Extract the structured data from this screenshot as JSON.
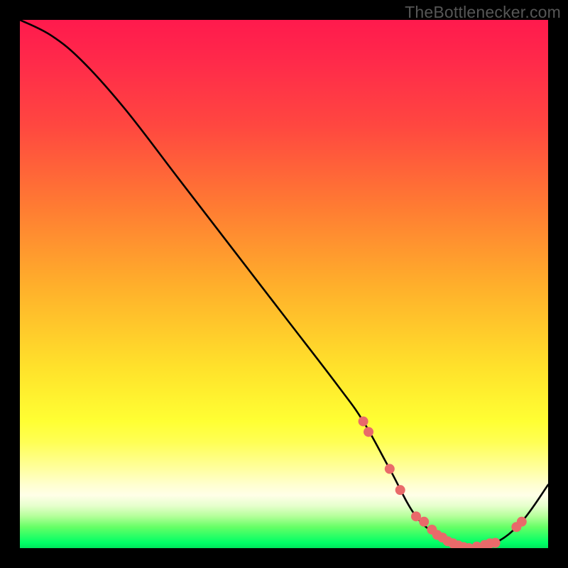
{
  "watermark": "TheBottlenecker.com",
  "chart_data": {
    "type": "line",
    "title": "",
    "xlabel": "",
    "ylabel": "",
    "xlim": [
      0,
      100
    ],
    "ylim": [
      0,
      100
    ],
    "series": [
      {
        "name": "curve",
        "x": [
          0,
          6,
          12,
          20,
          30,
          40,
          50,
          60,
          65,
          70,
          75,
          80,
          85,
          90,
          95,
          100
        ],
        "y": [
          100,
          97,
          92,
          83,
          70,
          57,
          44,
          31,
          24,
          15,
          6,
          2,
          0,
          1,
          5,
          12
        ]
      }
    ],
    "markers": {
      "color": "#e96a6a",
      "radius_px": 7,
      "points": [
        {
          "x": 65,
          "y": 24
        },
        {
          "x": 66,
          "y": 22
        },
        {
          "x": 70,
          "y": 15
        },
        {
          "x": 72,
          "y": 11
        },
        {
          "x": 75,
          "y": 6
        },
        {
          "x": 76.5,
          "y": 5
        },
        {
          "x": 78,
          "y": 3.5
        },
        {
          "x": 79,
          "y": 2.5
        },
        {
          "x": 80,
          "y": 2
        },
        {
          "x": 81,
          "y": 1.3
        },
        {
          "x": 82,
          "y": 0.9
        },
        {
          "x": 83,
          "y": 0.5
        },
        {
          "x": 84,
          "y": 0.2
        },
        {
          "x": 85,
          "y": 0
        },
        {
          "x": 86.5,
          "y": 0.3
        },
        {
          "x": 88,
          "y": 0.6
        },
        {
          "x": 89,
          "y": 0.9
        },
        {
          "x": 90,
          "y": 1
        },
        {
          "x": 94,
          "y": 4
        },
        {
          "x": 95,
          "y": 5
        }
      ]
    },
    "background_gradient": {
      "direction": "top-to-bottom",
      "stops": [
        {
          "pos": 0.0,
          "color": "#ff1a4d"
        },
        {
          "pos": 0.5,
          "color": "#ffae2b"
        },
        {
          "pos": 0.78,
          "color": "#ffff33"
        },
        {
          "pos": 0.9,
          "color": "#ffffe8"
        },
        {
          "pos": 1.0,
          "color": "#00e65c"
        }
      ]
    }
  }
}
